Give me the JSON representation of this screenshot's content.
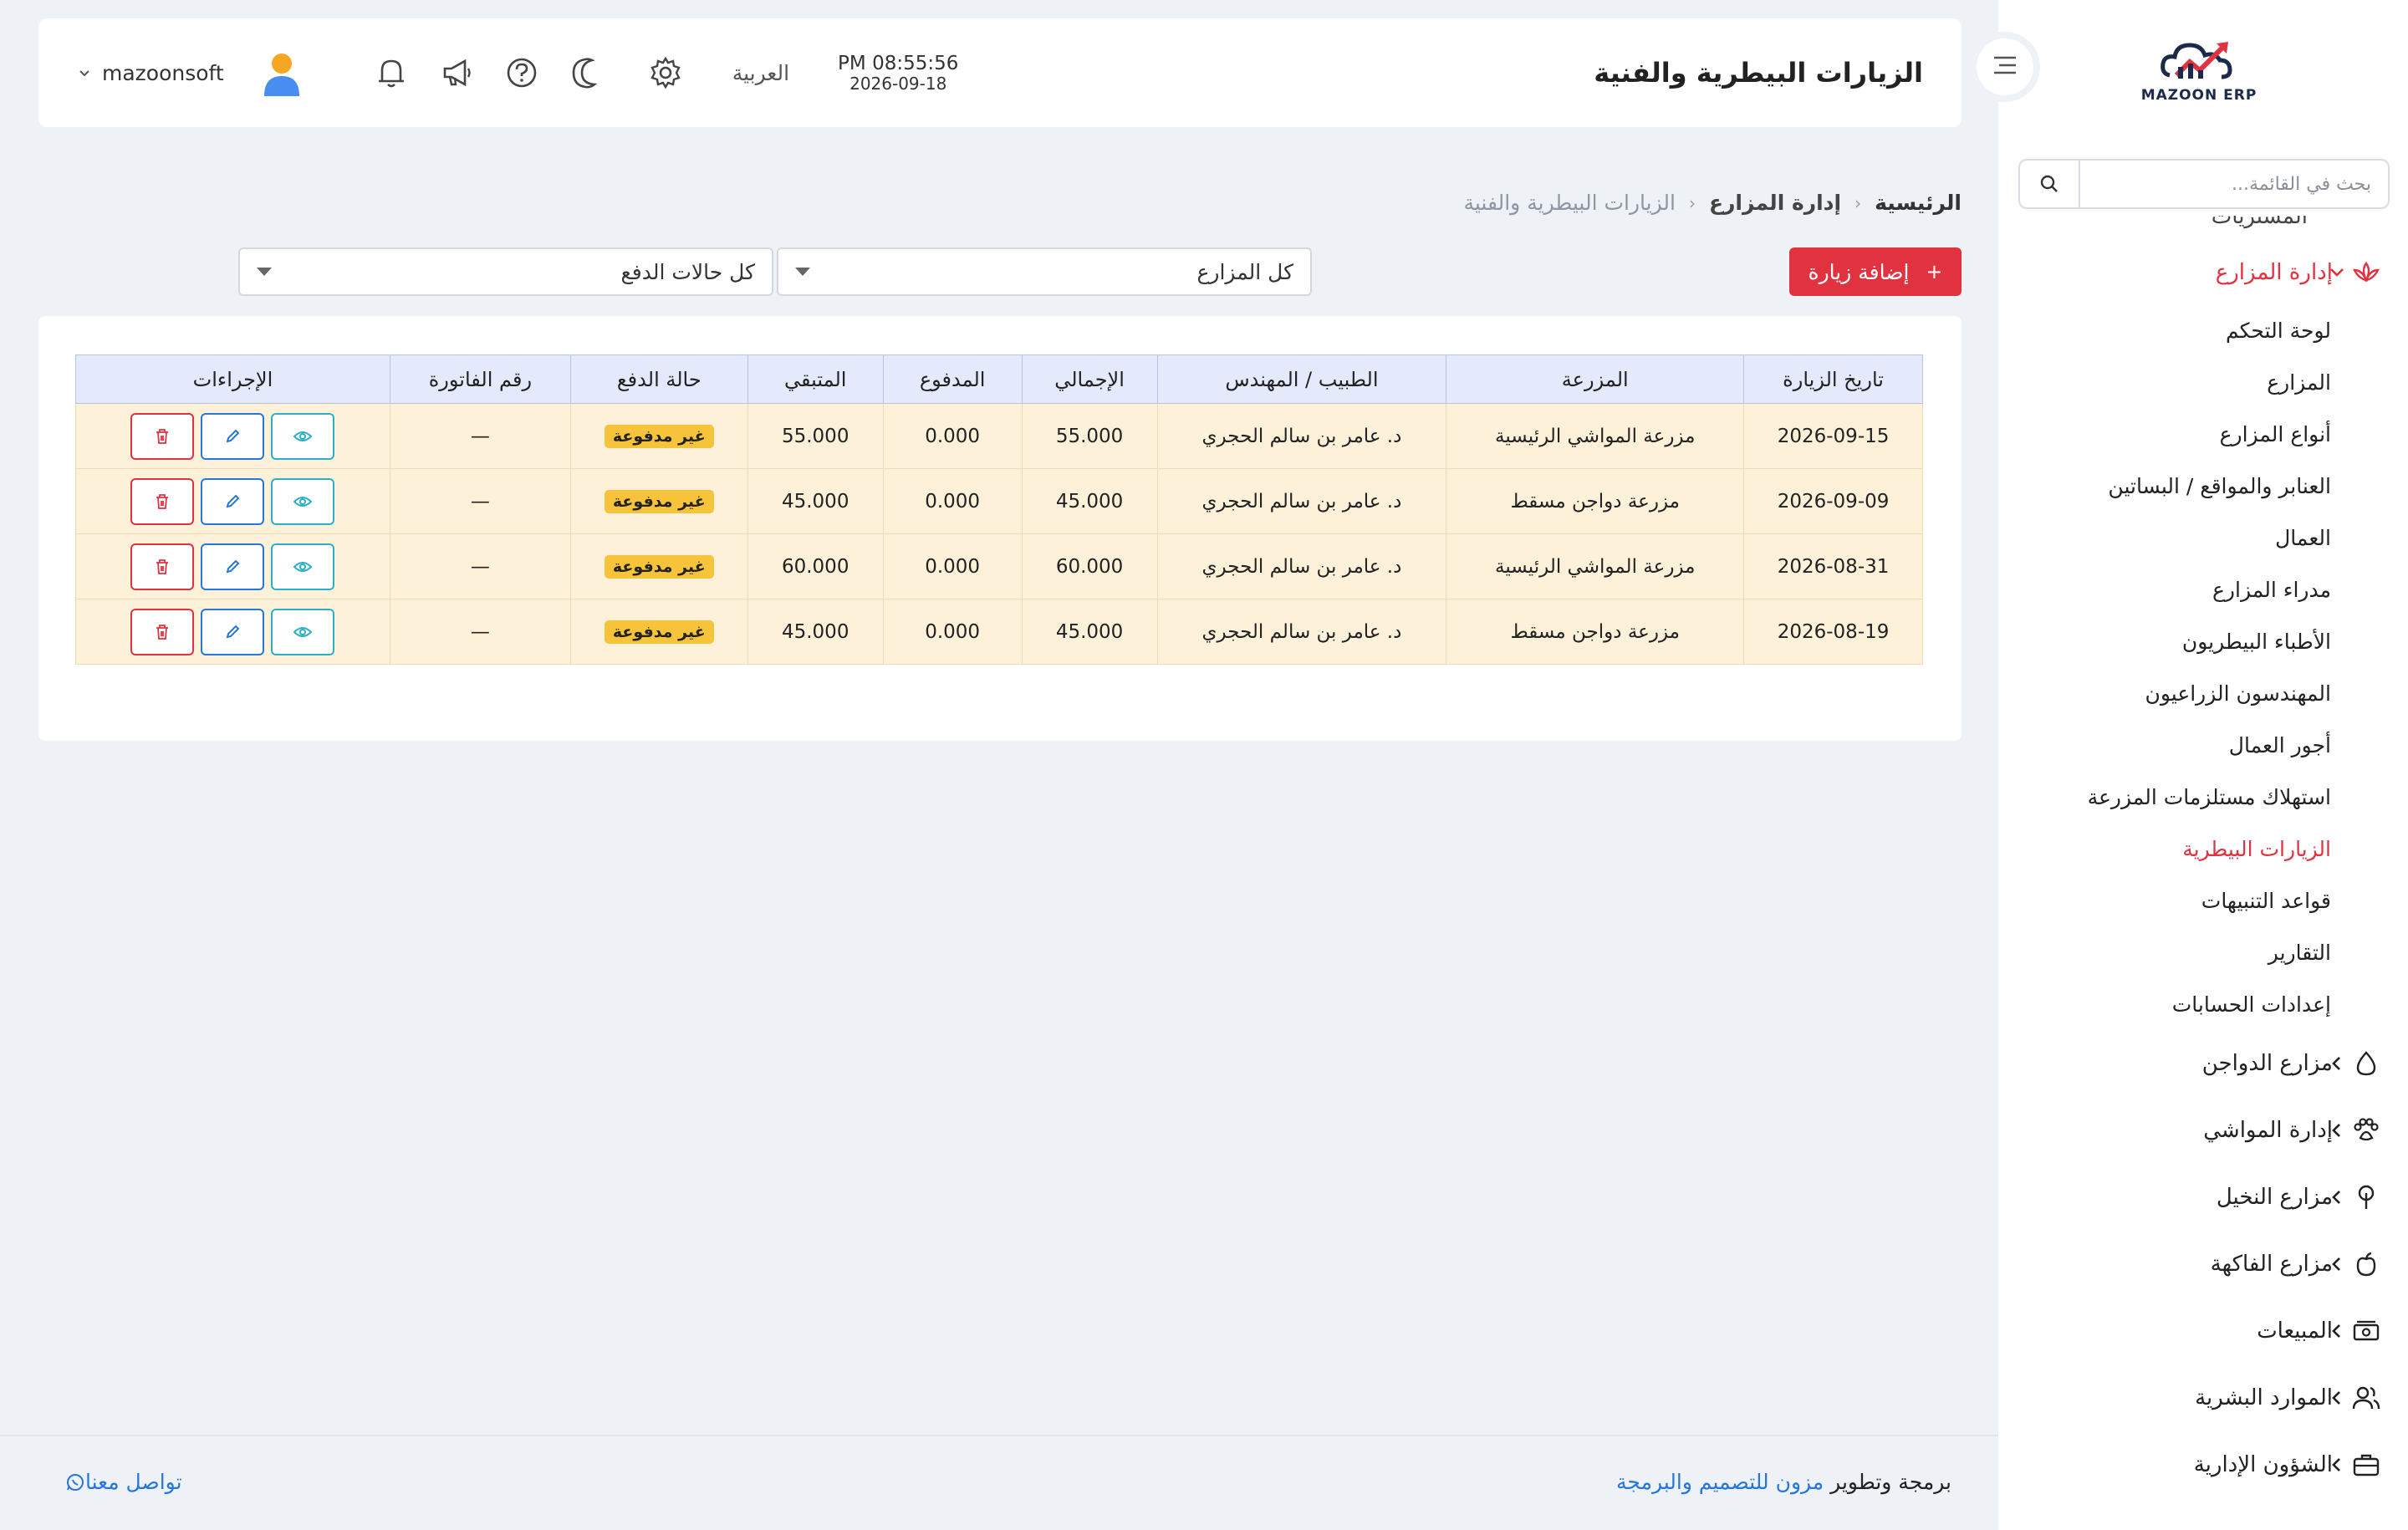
{
  "app": {
    "logo_text": "MAZOON ERP",
    "page_title": "الزيارات البيطرية والفنية"
  },
  "topbar": {
    "time": "PM 08:55:56",
    "date": "2026-09-18",
    "language": "العربية",
    "username": "mazoonsoft",
    "icons": [
      "settings-icon",
      "moon-icon",
      "help-icon",
      "megaphone-icon",
      "bell-icon"
    ]
  },
  "sidebar": {
    "search_placeholder": "بحث في القائمة...",
    "cut_item": "المشتريات",
    "active_group": {
      "label": "إدارة المزارع",
      "items": [
        {
          "label": "لوحة التحكم"
        },
        {
          "label": "المزارع"
        },
        {
          "label": "أنواع المزارع"
        },
        {
          "label": "العنابر والمواقع / البساتين"
        },
        {
          "label": "العمال"
        },
        {
          "label": "مدراء المزارع"
        },
        {
          "label": "الأطباء البيطريون"
        },
        {
          "label": "المهندسون الزراعيون"
        },
        {
          "label": "أجور العمال"
        },
        {
          "label": "استهلاك مستلزمات المزرعة"
        },
        {
          "label": "الزيارات البيطرية",
          "active": true
        },
        {
          "label": "قواعد التنبيهات"
        },
        {
          "label": "التقارير"
        },
        {
          "label": "إعدادات الحسابات"
        }
      ]
    },
    "groups": [
      {
        "label": "مزارع الدواجن",
        "icon": "egg-icon"
      },
      {
        "label": "إدارة المواشي",
        "icon": "paw-icon"
      },
      {
        "label": "مزارع النخيل",
        "icon": "tree-icon"
      },
      {
        "label": "مزارع الفاكهة",
        "icon": "apple-icon"
      },
      {
        "label": "المبيعات",
        "icon": "cash-icon"
      },
      {
        "label": "الموارد البشرية",
        "icon": "users-icon"
      },
      {
        "label": "الشؤون الإدارية",
        "icon": "briefcase-icon"
      }
    ]
  },
  "breadcrumb": {
    "home": "الرئيسية",
    "section": "إدارة المزارع",
    "current": "الزيارات البيطرية والفنية"
  },
  "filters": {
    "add_button": "إضافة زيارة",
    "farm_select": "كل المزارع",
    "payment_select": "كل حالات الدفع"
  },
  "table": {
    "headers": [
      "تاريخ الزيارة",
      "المزرعة",
      "الطبيب / المهندس",
      "الإجمالي",
      "المدفوع",
      "المتبقي",
      "حالة الدفع",
      "رقم الفاتورة",
      "الإجراءات"
    ],
    "rows": [
      {
        "date": "2026-09-15",
        "farm": "مزرعة المواشي الرئيسية",
        "doctor": "د. عامر بن سالم الحجري",
        "total": "55.000",
        "paid": "0.000",
        "remaining": "55.000",
        "status": "غير مدفوعة",
        "invoice": "—"
      },
      {
        "date": "2026-09-09",
        "farm": "مزرعة دواجن مسقط",
        "doctor": "د. عامر بن سالم الحجري",
        "total": "45.000",
        "paid": "0.000",
        "remaining": "45.000",
        "status": "غير مدفوعة",
        "invoice": "—"
      },
      {
        "date": "2026-08-31",
        "farm": "مزرعة المواشي الرئيسية",
        "doctor": "د. عامر بن سالم الحجري",
        "total": "60.000",
        "paid": "0.000",
        "remaining": "60.000",
        "status": "غير مدفوعة",
        "invoice": "—"
      },
      {
        "date": "2026-08-19",
        "farm": "مزرعة دواجن مسقط",
        "doctor": "د. عامر بن سالم الحجري",
        "total": "45.000",
        "paid": "0.000",
        "remaining": "45.000",
        "status": "غير مدفوعة",
        "invoice": "—"
      }
    ]
  },
  "footer": {
    "credit_prefix": "برمجة وتطوير",
    "credit_brand": "مزون للتصميم والبرمجة",
    "contact": "تواصل معنا"
  },
  "colors": {
    "accent": "#e0323f",
    "link": "#2677d9",
    "badge": "#f6c33b",
    "row_bg": "#fdf1da",
    "header_bg": "#e4eafb"
  }
}
